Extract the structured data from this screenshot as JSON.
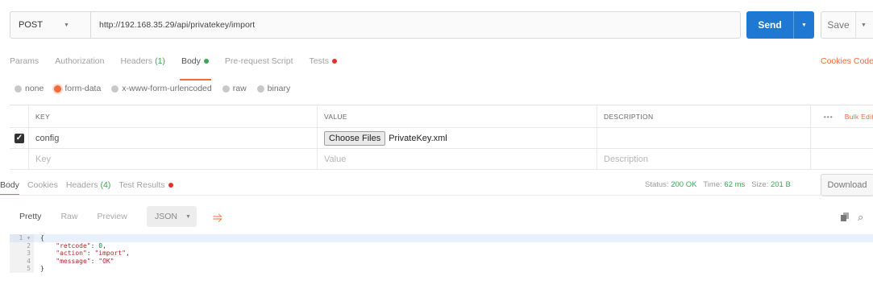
{
  "request": {
    "method": "POST",
    "url": "http://192.168.35.29/api/privatekey/import",
    "send_label": "Send",
    "save_label": "Save"
  },
  "request_tabs": [
    {
      "label": "Params"
    },
    {
      "label": "Authorization"
    },
    {
      "label": "Headers",
      "count": "(1)"
    },
    {
      "label": "Body"
    },
    {
      "label": "Pre-request Script"
    },
    {
      "label": "Tests"
    }
  ],
  "right_links": {
    "cookies": "Cookies",
    "code": "Code"
  },
  "body_types": [
    "none",
    "form-data",
    "x-www-form-urlencoded",
    "raw",
    "binary"
  ],
  "table": {
    "headers": {
      "key": "KEY",
      "value": "VALUE",
      "description": "DESCRIPTION",
      "more": "•••",
      "bulk_edit": "Bulk Edit"
    },
    "row": {
      "key": "config",
      "choose_files": "Choose Files",
      "file_name": "PrivateKey.xml"
    },
    "placeholders": {
      "key": "Key",
      "value": "Value",
      "description": "Description"
    }
  },
  "response_tabs": [
    {
      "label": "Body"
    },
    {
      "label": "Cookies"
    },
    {
      "label": "Headers",
      "count": "(4)"
    },
    {
      "label": "Test Results"
    }
  ],
  "status": {
    "status_label": "Status:",
    "status_value": "200 OK",
    "time_label": "Time:",
    "time_value": "62 ms",
    "size_label": "Size:",
    "size_value": "201 B"
  },
  "download_label": "Download",
  "view_tabs": [
    "Pretty",
    "Raw",
    "Preview"
  ],
  "format": "JSON",
  "code": {
    "line_numbers": [
      "1",
      "2",
      "3",
      "4",
      "5"
    ],
    "open": "{",
    "close": "}",
    "fields": [
      {
        "key": "\"retcode\"",
        "value": "0",
        "sep": ","
      },
      {
        "key": "\"action\"",
        "value": "\"import\"",
        "sep": ","
      },
      {
        "key": "\"message\"",
        "value": "\"OK\"",
        "sep": ""
      }
    ]
  },
  "colors": {
    "accent": "#f26b3a",
    "send_blue": "#1f78d1",
    "success_green": "#37a852",
    "error_red": "#e0312b"
  }
}
